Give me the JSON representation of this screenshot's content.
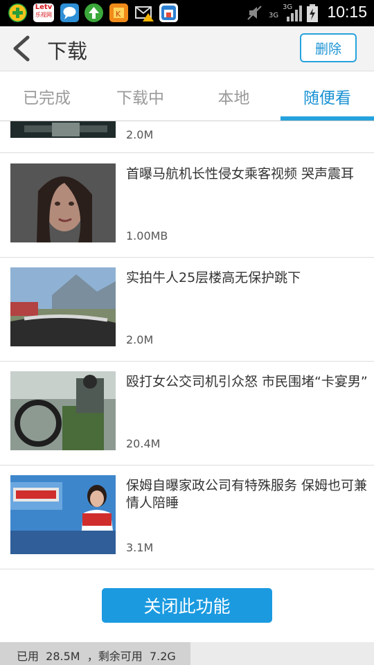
{
  "status_bar": {
    "time": "10:15",
    "network": "3G",
    "network2": "3G",
    "icons": [
      "add-icon",
      "letv-icon",
      "chat-bubble-icon",
      "upload-arrow-icon",
      "app-icon",
      "mail-warning-icon",
      "store-icon",
      "mute-icon",
      "signal-icon",
      "battery-icon"
    ],
    "letv_label": "Letv",
    "letv_sub": "乐视网"
  },
  "header": {
    "title": "下载",
    "delete_label": "删除"
  },
  "tabs": [
    {
      "label": "已完成",
      "active": false
    },
    {
      "label": "下载中",
      "active": false
    },
    {
      "label": "本地",
      "active": false
    },
    {
      "label": "随便看",
      "active": true
    }
  ],
  "items": [
    {
      "title": "",
      "size": "2.0M"
    },
    {
      "title": "首曝马航机长性侵女乘客视频 哭声震耳",
      "size": "1.00MB"
    },
    {
      "title": "实拍牛人25层楼高无保护跳下",
      "size": "2.0M"
    },
    {
      "title": "殴打女公交司机引众怒 市民围堵“卡宴男”",
      "size": "20.4M"
    },
    {
      "title": "保姆自曝家政公司有特殊服务 保姆也可兼情人陪睡",
      "size": "3.1M"
    }
  ],
  "close_label": "关闭此功能",
  "storage": {
    "text": "已用  28.5M  ，剩余可用  7.2G",
    "used_fraction": 0.51
  },
  "colors": {
    "accent": "#26a2dd",
    "button": "#1b9ae0"
  }
}
